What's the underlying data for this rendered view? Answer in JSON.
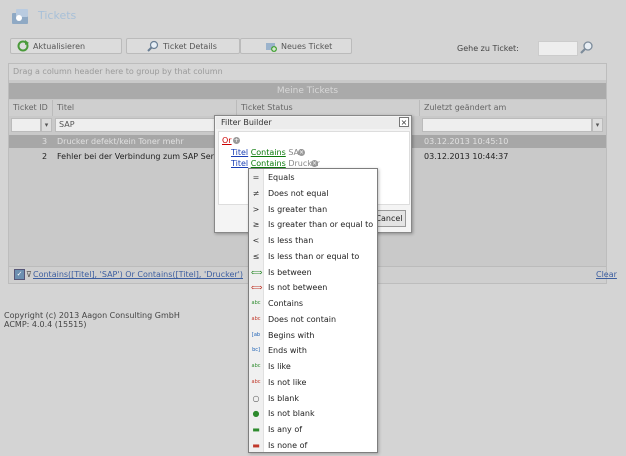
{
  "header": {
    "title": "Tickets"
  },
  "toolbar": {
    "refresh_label": "Aktualisieren",
    "details_label": "Ticket Details",
    "new_label": "Neues Ticket",
    "goto_label": "Gehe zu Ticket:",
    "goto_value": ""
  },
  "grid": {
    "group_hint": "Drag a column header here to group by that column",
    "title": "Meine Tickets",
    "columns": [
      "Ticket ID",
      "Titel",
      "Ticket Status",
      "Zuletzt geändert am"
    ],
    "filter_titel": "SAP",
    "rows": [
      {
        "id": "3",
        "titel": "Drucker defekt/kein Toner mehr",
        "date": "03.12.2013 10:45:10",
        "selected": true
      },
      {
        "id": "2",
        "titel": "Fehler bei der Verbindung zum SAP Server",
        "date": "03.12.2013 10:44:37",
        "selected": false
      }
    ],
    "filter_expression": "Contains([Titel], 'SAP') Or Contains([Titel], 'Drucker')",
    "clear_label": "Clear"
  },
  "footer": {
    "copyright": "Copyright (c) 2013 Aagon Consulting GmbH",
    "version": "ACMP: 4.0.4 (15515)"
  },
  "dialog": {
    "title": "Filter Builder",
    "group_operator": "Or",
    "conditions": [
      {
        "field": "Titel",
        "op": "Contains",
        "value": "SAP"
      },
      {
        "field": "Titel",
        "op": "Contains",
        "value": "Drucker"
      }
    ],
    "cancel_label": "Cancel"
  },
  "operator_menu": {
    "items": [
      {
        "label": "Equals",
        "icon": "equals-icon",
        "glyph": "=",
        "color": "#333333"
      },
      {
        "label": "Does not equal",
        "icon": "not-equal-icon",
        "glyph": "≠",
        "color": "#333333"
      },
      {
        "label": "Is greater than",
        "icon": "greater-than-icon",
        "glyph": ">",
        "color": "#333333"
      },
      {
        "label": "Is greater than or equal to",
        "icon": "greater-equal-icon",
        "glyph": "≥",
        "color": "#333333"
      },
      {
        "label": "Is less than",
        "icon": "less-than-icon",
        "glyph": "<",
        "color": "#333333"
      },
      {
        "label": "Is less than or equal to",
        "icon": "less-equal-icon",
        "glyph": "≤",
        "color": "#333333"
      },
      {
        "label": "Is between",
        "icon": "between-icon",
        "glyph": "⟺",
        "color": "#2e8b2e"
      },
      {
        "label": "Is not between",
        "icon": "not-between-icon",
        "glyph": "⟺",
        "color": "#c0392b"
      },
      {
        "label": "Contains",
        "icon": "contains-icon",
        "glyph": "abc",
        "color": "#2e8b2e"
      },
      {
        "label": "Does not contain",
        "icon": "not-contains-icon",
        "glyph": "abc",
        "color": "#c0392b"
      },
      {
        "label": "Begins with",
        "icon": "begins-with-icon",
        "glyph": "[ab",
        "color": "#1a5fb4"
      },
      {
        "label": "Ends with",
        "icon": "ends-with-icon",
        "glyph": "bc]",
        "color": "#1a5fb4"
      },
      {
        "label": "Is like",
        "icon": "like-icon",
        "glyph": "abc",
        "color": "#2e8b2e"
      },
      {
        "label": "Is not like",
        "icon": "not-like-icon",
        "glyph": "abc",
        "color": "#c0392b"
      },
      {
        "label": "Is blank",
        "icon": "blank-icon",
        "glyph": "○",
        "color": "#555555"
      },
      {
        "label": "Is not blank",
        "icon": "not-blank-icon",
        "glyph": "●",
        "color": "#2e8b2e"
      },
      {
        "label": "Is any of",
        "icon": "any-of-icon",
        "glyph": "▬",
        "color": "#2e8b2e"
      },
      {
        "label": "Is none of",
        "icon": "none-of-icon",
        "glyph": "▬",
        "color": "#c0392b"
      }
    ]
  }
}
